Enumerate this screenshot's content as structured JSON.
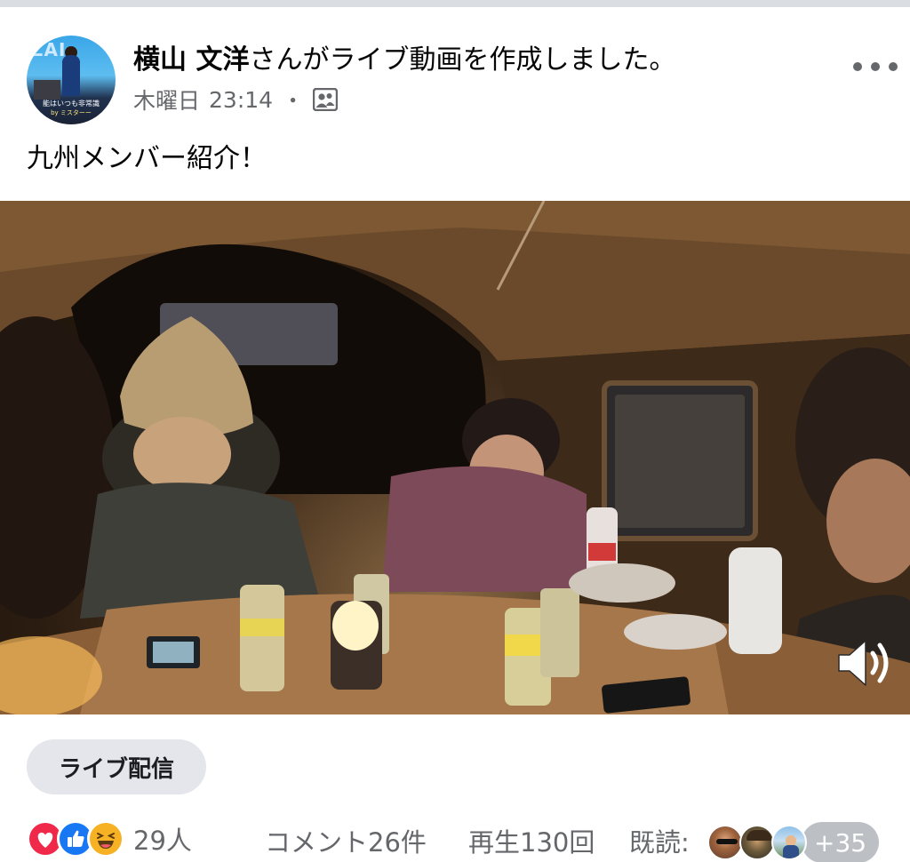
{
  "post": {
    "author": "横山 文洋",
    "action": "さんがライブ動画を作成しました。",
    "day": "木曜日",
    "time": "23:14",
    "separator": "・",
    "audience_icon": "friends-group-icon",
    "more_icon": "more-horizontal-icon",
    "text": "九州メンバー紹介！"
  },
  "avatar": {
    "logo_text": "ZAI",
    "caption": "能はいつも非常識",
    "caption2": "by ミスターー"
  },
  "video": {
    "volume_icon": "speaker-volume-icon"
  },
  "live_chip": {
    "label": "ライブ配信"
  },
  "stats": {
    "reactions": [
      "love",
      "like",
      "haha"
    ],
    "reaction_count": "29人",
    "comments": "コメント26件",
    "views": "再生130回",
    "seen_label": "既読:",
    "seen_more": "+35"
  },
  "colors": {
    "love": "#f02849",
    "like": "#1877f2",
    "haha": "#f7b125",
    "secondary_text": "#65676b",
    "chip_bg": "#e4e6eb"
  }
}
